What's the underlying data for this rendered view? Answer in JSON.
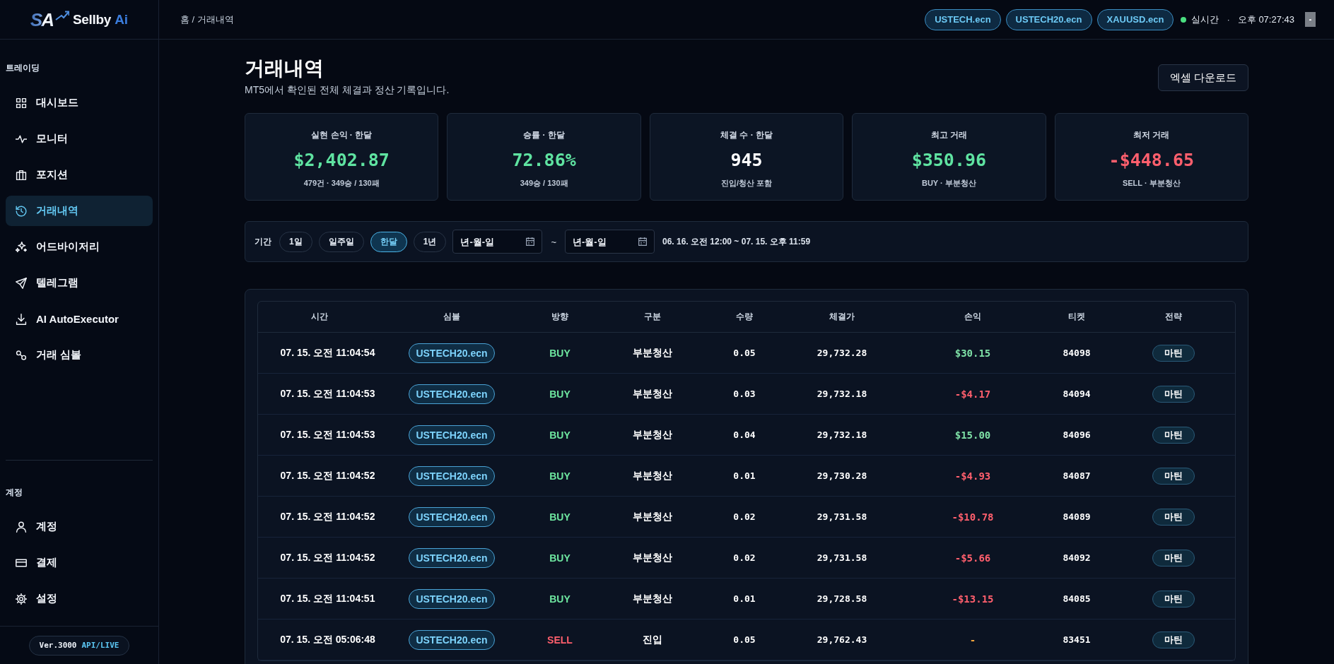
{
  "brand": {
    "mark": "SA",
    "name": "Sellby",
    "suffix": "Ai"
  },
  "sidebar": {
    "sections": [
      {
        "label": "트레이딩",
        "items": [
          {
            "label": "대시보드",
            "selected": false
          },
          {
            "label": "모니터",
            "selected": false
          },
          {
            "label": "포지션",
            "selected": false
          },
          {
            "label": "거래내역",
            "selected": true
          },
          {
            "label": "어드바이저리",
            "selected": false
          },
          {
            "label": "텔레그램",
            "selected": false
          },
          {
            "label": "AI AutoExecutor",
            "selected": false
          },
          {
            "label": "거래 심볼",
            "selected": false
          }
        ]
      },
      {
        "label": "계정",
        "items": [
          {
            "label": "계정",
            "selected": false
          },
          {
            "label": "결제",
            "selected": false
          },
          {
            "label": "설정",
            "selected": false
          }
        ]
      }
    ],
    "footer": {
      "version": "Ver.3000",
      "mode": "API/LIVE"
    }
  },
  "topbar": {
    "breadcrumb": "홈 / 거래내역",
    "symbols": [
      "USTECH.ecn",
      "USTECH20.ecn",
      "XAUUSD.ecn"
    ],
    "status": {
      "label": "실시간",
      "live": true
    },
    "separator": "·",
    "time": "오후 07:27:43",
    "button": "-"
  },
  "header": {
    "title": "거래내역",
    "subtitle": "MT5에서 확인된 전체 체결과 정산 기록입니다.",
    "action": "엑셀 다운로드"
  },
  "stats": [
    {
      "label": "실현 손익 · 한달",
      "value": "$2,402.87",
      "sub": "479건 · 349승 / 130패",
      "color": "#5fe3a1"
    },
    {
      "label": "승률 · 한달",
      "value": "72.86%",
      "sub": "349승 / 130패",
      "color": "#5fe3a1"
    },
    {
      "label": "체결 수 · 한달",
      "value": "945",
      "sub": "진입/청산 포함",
      "color": "#ffffff"
    },
    {
      "label": "최고 거래",
      "value": "$350.96",
      "sub": "BUY · 부분청산",
      "color": "#5fe3a1"
    },
    {
      "label": "최저 거래",
      "value": "-$448.65",
      "sub": "SELL · 부분청산",
      "color": "#ff5f6d"
    }
  ],
  "filter": {
    "label": "기간",
    "periods": [
      {
        "label": "1일",
        "selected": false
      },
      {
        "label": "일주일",
        "selected": false
      },
      {
        "label": "한달",
        "selected": true
      },
      {
        "label": "1년",
        "selected": false
      }
    ],
    "date_from": {
      "placeholder": "년-월-일"
    },
    "range_separator": "~",
    "date_to": {
      "placeholder": "년-월-일"
    },
    "range": "06. 16. 오전 12:00 ~ 07. 15. 오후 11:59"
  },
  "table": {
    "columns": [
      "시간",
      "심볼",
      "방향",
      "구분",
      "수량",
      "체결가",
      "손익",
      "티켓",
      "전략"
    ],
    "rows": [
      {
        "time": "07. 15. 오전 11:04:54",
        "symbol": "USTECH20.ecn",
        "direction": {
          "text": "BUY",
          "color": "#6ee7a0"
        },
        "type": "부분청산",
        "quantity": "0.05",
        "price": "29,732.28",
        "pnl": {
          "text": "$30.15",
          "color": "#7ee0a6"
        },
        "ticket": "84098",
        "strategy": "마틴"
      },
      {
        "time": "07. 15. 오전 11:04:53",
        "symbol": "USTECH20.ecn",
        "direction": {
          "text": "BUY",
          "color": "#6ee7a0"
        },
        "type": "부분청산",
        "quantity": "0.03",
        "price": "29,732.18",
        "pnl": {
          "text": "-$4.17",
          "color": "#ff5f6d"
        },
        "ticket": "84094",
        "strategy": "마틴"
      },
      {
        "time": "07. 15. 오전 11:04:53",
        "symbol": "USTECH20.ecn",
        "direction": {
          "text": "BUY",
          "color": "#6ee7a0"
        },
        "type": "부분청산",
        "quantity": "0.04",
        "price": "29,732.18",
        "pnl": {
          "text": "$15.00",
          "color": "#7ee0a6"
        },
        "ticket": "84096",
        "strategy": "마틴"
      },
      {
        "time": "07. 15. 오전 11:04:52",
        "symbol": "USTECH20.ecn",
        "direction": {
          "text": "BUY",
          "color": "#6ee7a0"
        },
        "type": "부분청산",
        "quantity": "0.01",
        "price": "29,730.28",
        "pnl": {
          "text": "-$4.93",
          "color": "#ff5f6d"
        },
        "ticket": "84087",
        "strategy": "마틴"
      },
      {
        "time": "07. 15. 오전 11:04:52",
        "symbol": "USTECH20.ecn",
        "direction": {
          "text": "BUY",
          "color": "#6ee7a0"
        },
        "type": "부분청산",
        "quantity": "0.02",
        "price": "29,731.58",
        "pnl": {
          "text": "-$10.78",
          "color": "#ff5f6d"
        },
        "ticket": "84089",
        "strategy": "마틴"
      },
      {
        "time": "07. 15. 오전 11:04:52",
        "symbol": "USTECH20.ecn",
        "direction": {
          "text": "BUY",
          "color": "#6ee7a0"
        },
        "type": "부분청산",
        "quantity": "0.02",
        "price": "29,731.58",
        "pnl": {
          "text": "-$5.66",
          "color": "#ff5f6d"
        },
        "ticket": "84092",
        "strategy": "마틴"
      },
      {
        "time": "07. 15. 오전 11:04:51",
        "symbol": "USTECH20.ecn",
        "direction": {
          "text": "BUY",
          "color": "#6ee7a0"
        },
        "type": "부분청산",
        "quantity": "0.01",
        "price": "29,728.58",
        "pnl": {
          "text": "-$13.15",
          "color": "#ff5f6d"
        },
        "ticket": "84085",
        "strategy": "마틴"
      },
      {
        "time": "07. 15. 오전 05:06:48",
        "symbol": "USTECH20.ecn",
        "direction": {
          "text": "SELL",
          "color": "#ff5f6d"
        },
        "type": "진입",
        "quantity": "0.05",
        "price": "29,762.43",
        "pnl": {
          "text": "-",
          "color": "#f4a53c"
        },
        "ticket": "83451",
        "strategy": "마틴"
      }
    ]
  }
}
